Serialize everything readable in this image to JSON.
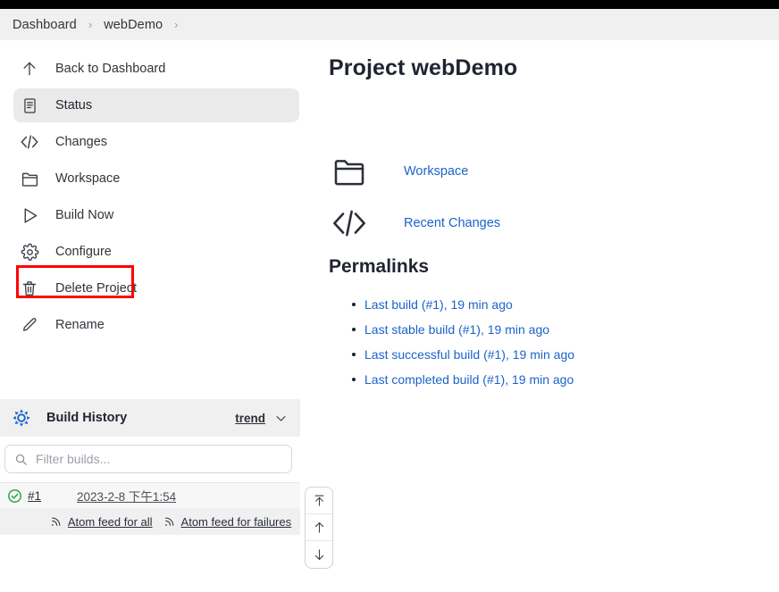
{
  "breadcrumb": {
    "items": [
      "Dashboard",
      "webDemo"
    ],
    "separator": "›"
  },
  "sidebar": {
    "nav_items": [
      {
        "label": "Back to Dashboard",
        "icon": "arrow-up-icon",
        "selected": false
      },
      {
        "label": "Status",
        "icon": "document-icon",
        "selected": true
      },
      {
        "label": "Changes",
        "icon": "code-brackets-icon",
        "selected": false
      },
      {
        "label": "Workspace",
        "icon": "folder-icon",
        "selected": false
      },
      {
        "label": "Build Now",
        "icon": "play-icon",
        "selected": false
      },
      {
        "label": "Configure",
        "icon": "gear-icon",
        "selected": false
      },
      {
        "label": "Delete Project",
        "icon": "trash-icon",
        "selected": false
      },
      {
        "label": "Rename",
        "icon": "pencil-icon",
        "selected": false
      }
    ],
    "annotation": {
      "target": "Configure",
      "color": "#ff0000"
    },
    "build_history": {
      "title": "Build History",
      "icon": "jenkins-burst-icon",
      "trend_label": "trend",
      "chevron": "chevron-down-icon",
      "filter_placeholder": "Filter builds...",
      "filter_value": "",
      "search_icon": "search-icon",
      "builds": [
        {
          "status_icon": "success-check-icon",
          "number": "#1",
          "date": "2023-2-8 下午1:54"
        }
      ],
      "feeds": [
        {
          "label": "Atom feed for all",
          "icon": "rss-icon"
        },
        {
          "label": "Atom feed for failures",
          "icon": "rss-icon"
        }
      ]
    },
    "scroll_buttons": [
      {
        "name": "scroll-to-top",
        "icon": "arrow-to-top-icon"
      },
      {
        "name": "scroll-up",
        "icon": "arrow-up-icon"
      },
      {
        "name": "scroll-down",
        "icon": "arrow-down-icon"
      }
    ]
  },
  "main": {
    "title": "Project webDemo",
    "actions": [
      {
        "label": "Workspace",
        "icon": "folder-icon"
      },
      {
        "label": "Recent Changes",
        "icon": "code-brackets-icon"
      }
    ],
    "permalinks": {
      "title": "Permalinks",
      "links": [
        "Last build (#1), 19 min ago",
        "Last stable build (#1), 19 min ago",
        "Last successful build (#1), 19 min ago",
        "Last completed build (#1), 19 min ago"
      ]
    }
  },
  "colors": {
    "link": "#1b63c9",
    "accent": "#1b63c9",
    "annotation": "#ff0000",
    "success": "#23a341",
    "bar": "#f0f0f0"
  }
}
